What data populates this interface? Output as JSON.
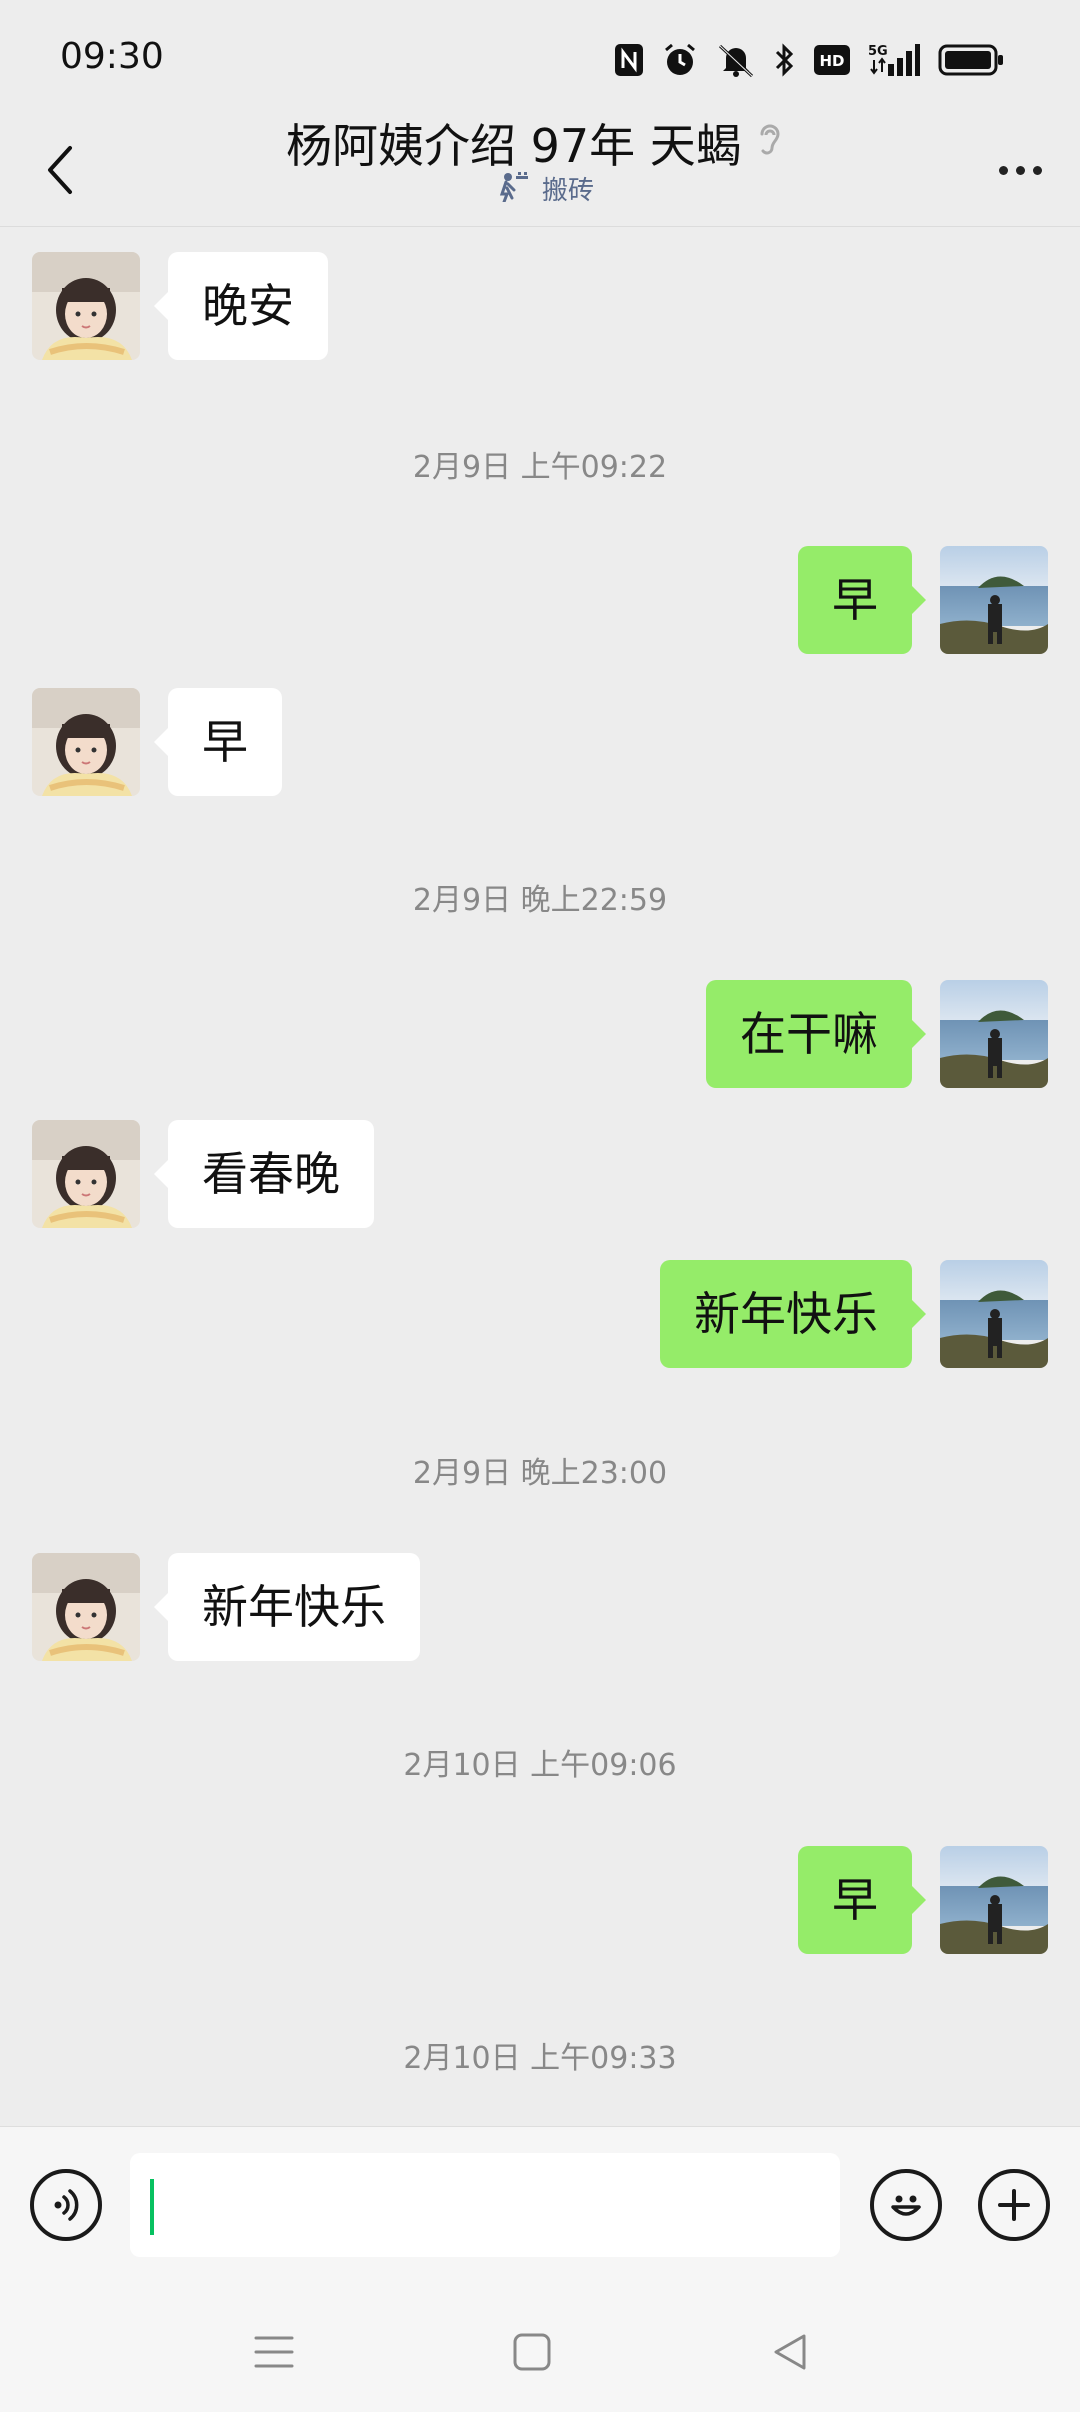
{
  "status_bar": {
    "time": "09:30",
    "icons": [
      "nfc-icon",
      "alarm-icon",
      "mute-icon",
      "bluetooth-icon",
      "hd-icon",
      "5g-signal-icon",
      "battery-icon"
    ],
    "hd_label": "HD",
    "network_label": "5G"
  },
  "header": {
    "title": "杨阿姨介绍 97年 天蝎",
    "subtitle": "搬砖",
    "back_icon": "chevron-left-icon",
    "more_icon": "more-dots-icon",
    "ear_icon": "ear-icon"
  },
  "messages": [
    {
      "type": "in",
      "text": "晚安"
    },
    {
      "type": "time",
      "text": "2月9日 上午09:22"
    },
    {
      "type": "out",
      "text": "早"
    },
    {
      "type": "in",
      "text": "早"
    },
    {
      "type": "time",
      "text": "2月9日 晚上22:59"
    },
    {
      "type": "out",
      "text": "在干嘛"
    },
    {
      "type": "in",
      "text": "看春晚"
    },
    {
      "type": "out",
      "text": "新年快乐"
    },
    {
      "type": "time",
      "text": "2月9日 晚上23:00"
    },
    {
      "type": "in",
      "text": "新年快乐"
    },
    {
      "type": "time",
      "text": "2月10日 上午09:06"
    },
    {
      "type": "out",
      "text": "早"
    },
    {
      "type": "time",
      "text": "2月10日 上午09:33"
    }
  ],
  "input_bar": {
    "voice_icon": "voice-icon",
    "emoji_icon": "emoji-icon",
    "plus_icon": "plus-icon",
    "input_value": ""
  },
  "nav_bar": {
    "icons": [
      "menu-icon",
      "home-square-icon",
      "back-triangle-icon"
    ]
  },
  "colors": {
    "background": "#ededed",
    "outgoing_bubble": "#95ec69",
    "incoming_bubble": "#ffffff",
    "caret": "#07c160"
  }
}
